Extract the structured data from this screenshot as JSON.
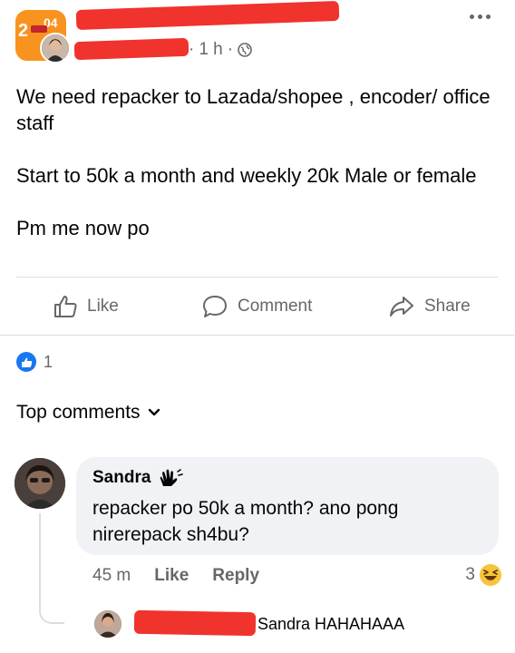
{
  "post": {
    "page_badge": "2",
    "page_badge_alt": "04",
    "time": "1 h",
    "separator": "·",
    "body": [
      "We need repacker to Lazada/shopee , encoder/ office staff",
      "Start to 50k a month and weekly 20k Male or female",
      "Pm me now po"
    ]
  },
  "actions": {
    "like": "Like",
    "comment": "Comment",
    "share": "Share"
  },
  "reactions": {
    "count": "1"
  },
  "comments_header": {
    "label": "Top comments"
  },
  "comment": {
    "author": "Sandra",
    "text": "repacker po 50k a month? ano pong nirerepack sh4bu?",
    "time": "45 m",
    "like": "Like",
    "reply": "Reply",
    "reaction_count": "3"
  },
  "reply": {
    "text": "Sandra HAHAHAAA"
  },
  "colors": {
    "accent": "#1877f2",
    "redaction": "#f0332d",
    "muted": "#65676b"
  }
}
